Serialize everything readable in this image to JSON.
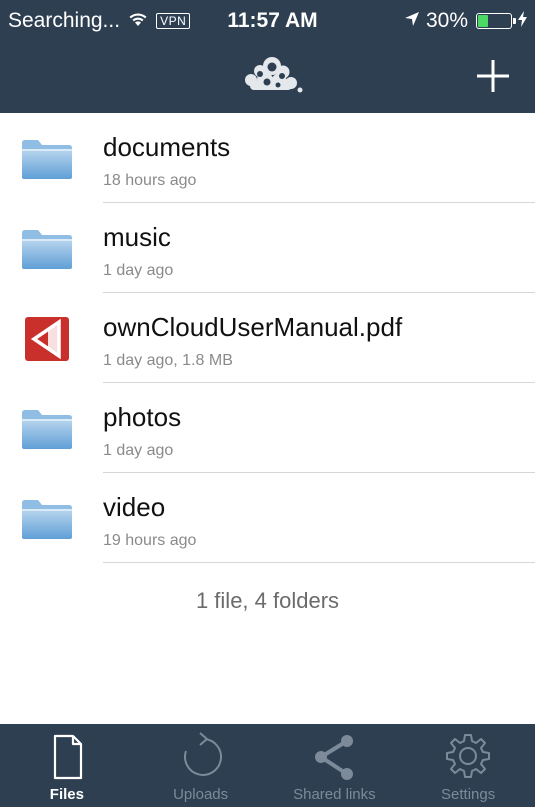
{
  "status_bar": {
    "carrier": "Searching...",
    "vpn": "VPN",
    "time": "11:57 AM",
    "battery": "30%",
    "battery_level": 0.3,
    "icons": [
      "wifi-icon",
      "location-arrow-icon",
      "battery-icon",
      "charging-icon"
    ]
  },
  "header": {
    "logo_icon": "owncloud-logo-icon",
    "add_icon": "plus-icon"
  },
  "files": [
    {
      "name": "documents",
      "meta": "18 hours ago",
      "type": "folder"
    },
    {
      "name": "music",
      "meta": "1 day ago",
      "type": "folder"
    },
    {
      "name": "ownCloudUserManual.pdf",
      "meta": "1 day ago, 1.8 MB",
      "type": "pdf"
    },
    {
      "name": "photos",
      "meta": "1 day ago",
      "type": "folder"
    },
    {
      "name": "video",
      "meta": "19 hours ago",
      "type": "folder"
    }
  ],
  "summary": "1 file, 4 folders",
  "tabs": [
    {
      "label": "Files",
      "icon": "file-icon",
      "active": true
    },
    {
      "label": "Uploads",
      "icon": "refresh-icon",
      "active": false
    },
    {
      "label": "Shared links",
      "icon": "share-icon",
      "active": false
    },
    {
      "label": "Settings",
      "icon": "gear-icon",
      "active": false
    }
  ],
  "colors": {
    "bar_background": "#2e3f52",
    "active_tab": "#ffffff",
    "inactive_tab": "#7c8a99",
    "battery_fill": "#4cd964",
    "pdf_red": "#c9302c"
  }
}
